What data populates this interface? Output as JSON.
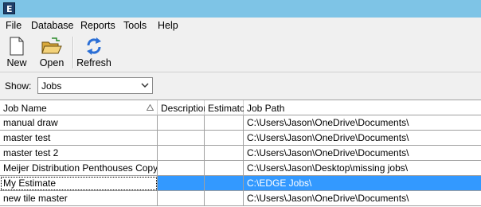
{
  "titlebar": {
    "icon": "app-e-icon"
  },
  "menu": [
    "File",
    "Database",
    "Reports",
    "Tools",
    "Help"
  ],
  "toolbar": {
    "new_label": "New",
    "open_label": "Open",
    "refresh_label": "Refresh"
  },
  "filter": {
    "show_label": "Show:",
    "selected": "Jobs"
  },
  "grid": {
    "columns": [
      "Job Name",
      "Description",
      "Estimator",
      "Job Path"
    ],
    "rows": [
      {
        "name": "manual draw",
        "description": "",
        "estimator": "",
        "path": "C:\\Users\\Jason\\OneDrive\\Documents\\"
      },
      {
        "name": "master test",
        "description": "",
        "estimator": "",
        "path": "C:\\Users\\Jason\\OneDrive\\Documents\\"
      },
      {
        "name": "master test 2",
        "description": "",
        "estimator": "",
        "path": "C:\\Users\\Jason\\OneDrive\\Documents\\"
      },
      {
        "name": "Meijer Distribution Penthouses Copy",
        "description": "",
        "estimator": "",
        "path": "C:\\Users\\Jason\\Desktop\\missing jobs\\"
      },
      {
        "name": "My Estimate",
        "description": "",
        "estimator": "",
        "path": "C:\\EDGE Jobs\\"
      },
      {
        "name": "new tile master",
        "description": "",
        "estimator": "",
        "path": "C:\\Users\\Jason\\OneDrive\\Documents\\"
      }
    ],
    "selected_row": 4
  },
  "colors": {
    "titlebar": "#7ec4e6",
    "selection": "#3399ff"
  }
}
